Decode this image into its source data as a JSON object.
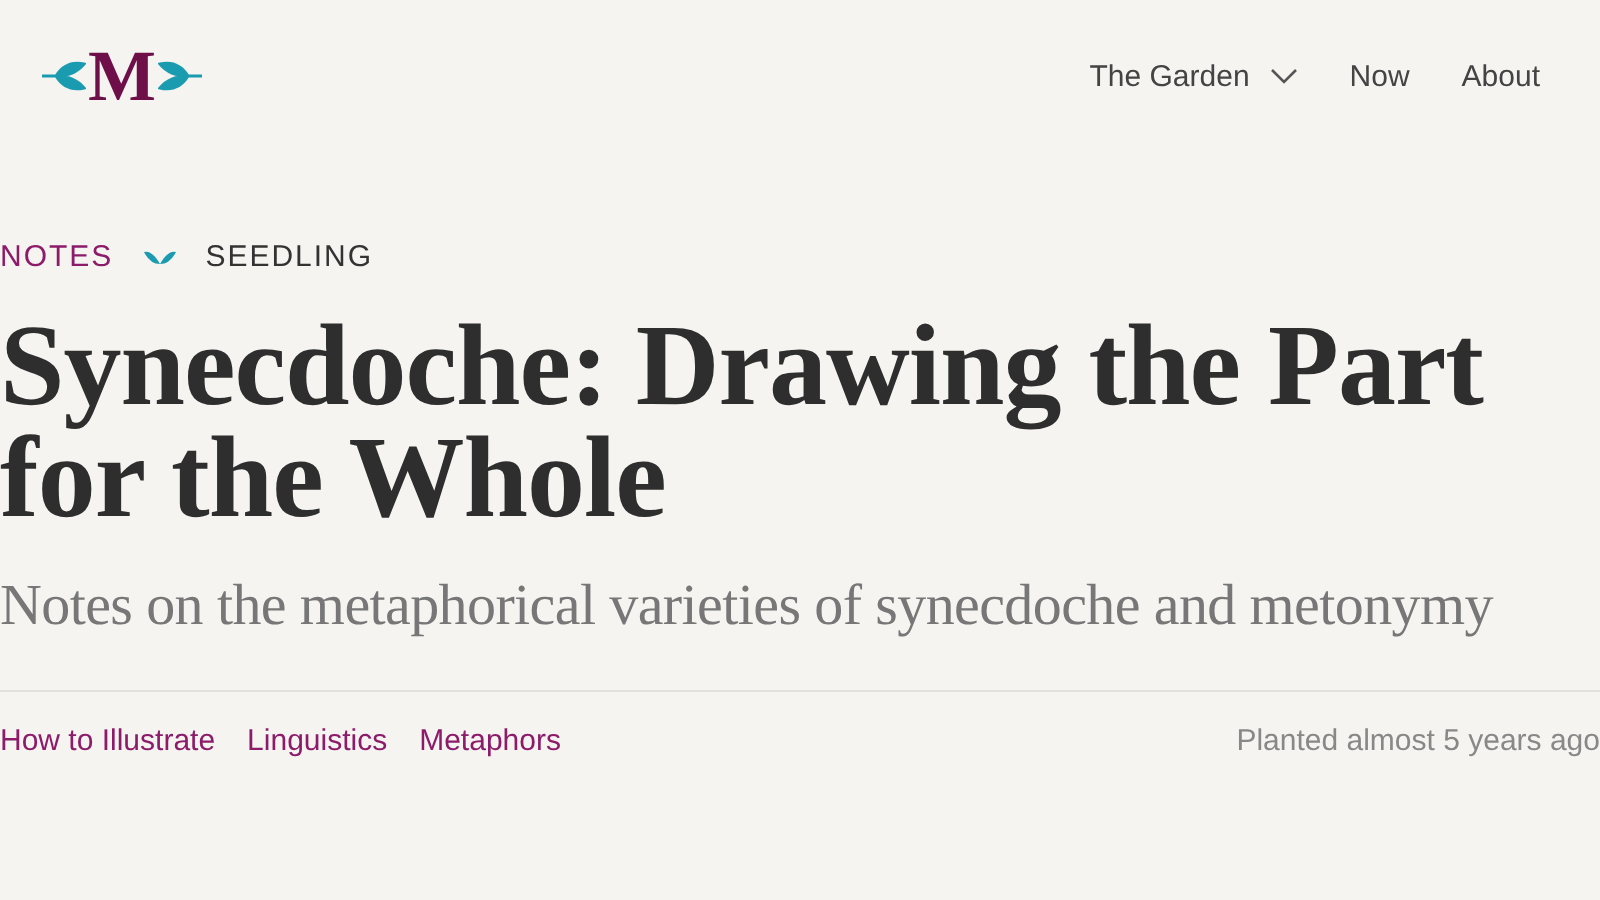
{
  "logo": {
    "letter": "M"
  },
  "nav": [
    {
      "label": "The Garden",
      "has_menu": true
    },
    {
      "label": "Now",
      "has_menu": false
    },
    {
      "label": "About",
      "has_menu": false
    }
  ],
  "breadcrumb": {
    "category": "NOTES",
    "stage": "SEEDLING"
  },
  "title": "Synecdoche: Drawing the Part for the Whole",
  "subtitle": "Notes on the metaphorical varieties of synecdoche and metonymy",
  "topics": [
    "How to Illustrate",
    "Linguistics",
    "Metaphors"
  ],
  "planted": "Planted almost 5 years ago"
}
